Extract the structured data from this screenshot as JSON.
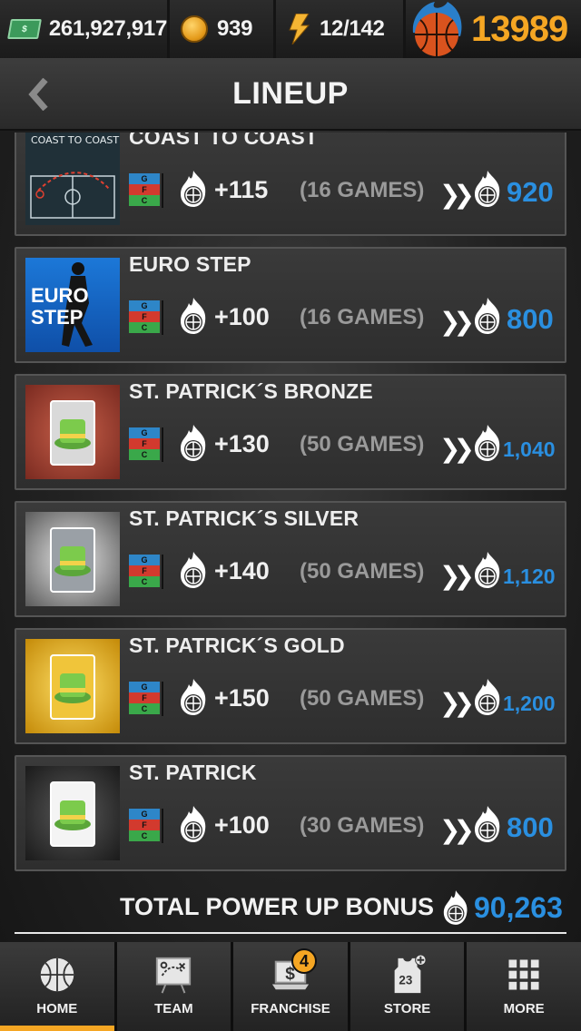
{
  "currency": {
    "cash": "261,927,917",
    "coins": "939",
    "energy": "12/142",
    "rating": "13989"
  },
  "header": {
    "title": "LINEUP"
  },
  "power_ups": [
    {
      "name": "COAST TO COAST",
      "boost": "+115",
      "games": "(16 GAMES)",
      "total": "920",
      "thumb_caption": "COAST TO COAST"
    },
    {
      "name": "EURO STEP",
      "boost": "+100",
      "games": "(16 GAMES)",
      "total": "800",
      "thumb_caption": "EURO STEP"
    },
    {
      "name": "ST. PATRICK´S BRONZE",
      "boost": "+130",
      "games": "(50 GAMES)",
      "total": "1,040"
    },
    {
      "name": "ST. PATRICK´S SILVER",
      "boost": "+140",
      "games": "(50 GAMES)",
      "total": "1,120"
    },
    {
      "name": "ST. PATRICK´S GOLD",
      "boost": "+150",
      "games": "(50 GAMES)",
      "total": "1,200"
    },
    {
      "name": "ST. PATRICK",
      "boost": "+100",
      "games": "(30 GAMES)",
      "total": "800"
    }
  ],
  "positions": {
    "g": "G",
    "f": "F",
    "c": "C"
  },
  "total": {
    "label": "TOTAL POWER UP BONUS",
    "value": "90,263"
  },
  "nav": [
    {
      "label": "HOME",
      "icon": "basketball-icon",
      "active": true
    },
    {
      "label": "TEAM",
      "icon": "playbook-icon"
    },
    {
      "label": "FRANCHISE",
      "icon": "laptop-dollar-icon",
      "badge": "4"
    },
    {
      "label": "STORE",
      "icon": "jersey-icon",
      "jersey_number": "23"
    },
    {
      "label": "MORE",
      "icon": "grid-icon"
    }
  ],
  "colors": {
    "accent_orange": "#f5a623",
    "value_blue": "#2a8fe0",
    "guard_blue": "#2e86c8",
    "forward_red": "#d23a2e",
    "center_green": "#3aa84a"
  }
}
